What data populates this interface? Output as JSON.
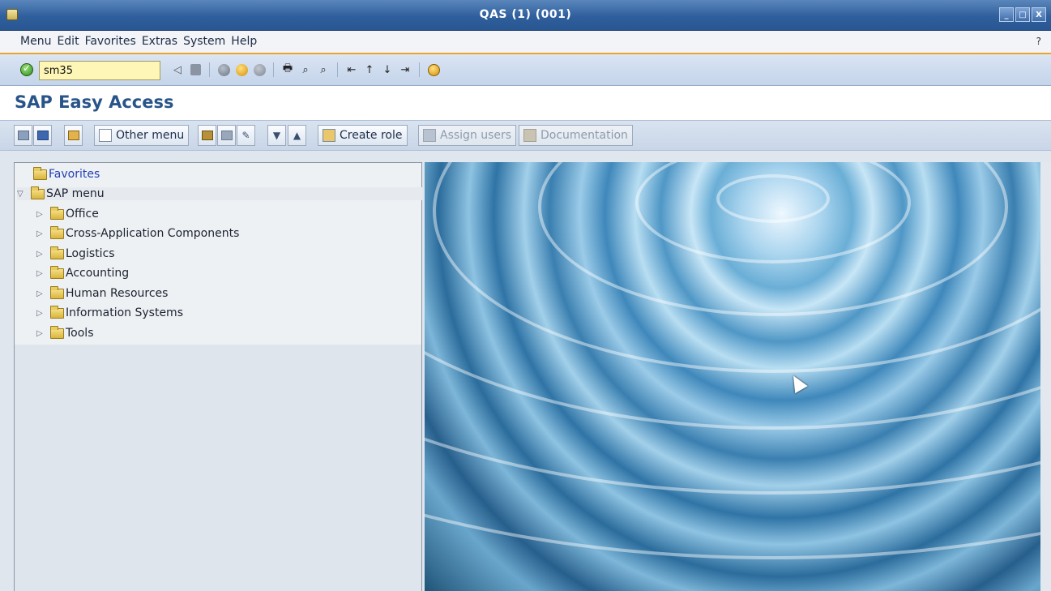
{
  "window": {
    "title": "QAS (1) (001)",
    "controls": [
      "_",
      "□",
      "X"
    ]
  },
  "menubar": {
    "items": [
      "Menu",
      "Edit",
      "Favorites",
      "Extras",
      "System",
      "Help"
    ],
    "help_mark": "?"
  },
  "std_toolbar": {
    "command_value": "sm35",
    "icons": [
      "enter-icon",
      "back-icon",
      "save-icon",
      "back-green-icon",
      "exit-icon",
      "cancel-icon",
      "print-icon",
      "find-icon",
      "find-next-icon",
      "first-page-icon",
      "previous-page-icon",
      "next-page-icon",
      "last-page-icon",
      "help-icon"
    ]
  },
  "screen": {
    "title": "SAP Easy Access"
  },
  "app_toolbar": {
    "other_menu": "Other menu",
    "create_role": "Create role",
    "assign_users": "Assign users",
    "documentation": "Documentation"
  },
  "tree": {
    "favorites": "Favorites",
    "sap_menu": "SAP menu",
    "children": [
      "Office",
      "Cross-Application Components",
      "Logistics",
      "Accounting",
      "Human Resources",
      "Information Systems",
      "Tools"
    ]
  },
  "colors": {
    "title_bar": "#2f5f9c",
    "accent_orange": "#e7a431",
    "screen_title": "#28548a",
    "command_field": "#fdf6b6"
  }
}
